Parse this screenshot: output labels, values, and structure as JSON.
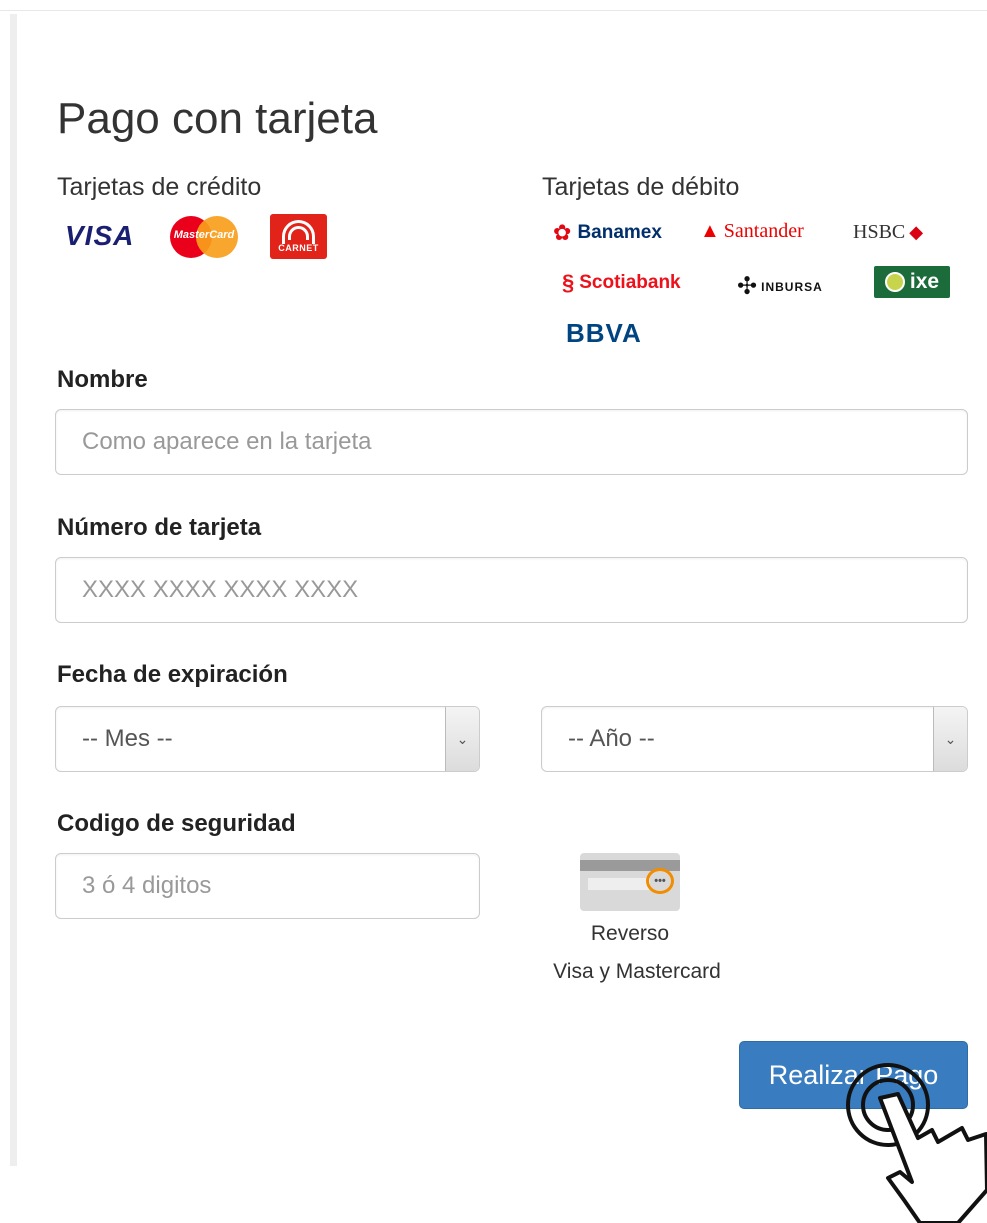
{
  "page": {
    "title": "Pago con tarjeta"
  },
  "credit": {
    "heading": "Tarjetas de crédito",
    "brands": {
      "visa": "VISA",
      "mastercard": "MasterCard",
      "carnet": "CARNET"
    }
  },
  "debit": {
    "heading": "Tarjetas de débito",
    "brands": {
      "banamex": "Banamex",
      "santander": "Santander",
      "hsbc": "HSBC",
      "scotiabank": "Scotiabank",
      "inbursa": "INBURSA",
      "ixe": "ixe",
      "bbva": "BBVA"
    }
  },
  "form": {
    "name": {
      "label": "Nombre",
      "placeholder": "Como aparece en la tarjeta"
    },
    "card_number": {
      "label": "Número de tarjeta",
      "placeholder": "XXXX XXXX XXXX XXXX"
    },
    "expiration": {
      "label": "Fecha de expiración",
      "month_selected": "-- Mes --",
      "year_selected": "-- Año --"
    },
    "security_code": {
      "label": "Codigo de seguridad",
      "placeholder": "3 ó 4 digitos"
    },
    "card_back": {
      "caption_line1": "Reverso",
      "caption_line2": "Visa y Mastercard",
      "cvv_dots": "•••"
    },
    "submit_label": "Realizar Pago"
  },
  "colors": {
    "button": "#3a7cc0",
    "visa": "#1a1f71",
    "mastercard_red": "#eb001b",
    "mastercard_orange": "#f79e1b",
    "carnet": "#e2231a",
    "santander": "#ec0000",
    "scotiabank": "#ec111a",
    "ixe": "#1c6b3a",
    "bbva": "#004481"
  },
  "icons": {
    "select_arrow": "chevron-down-icon",
    "cursor": "hand-pointer-icon"
  }
}
